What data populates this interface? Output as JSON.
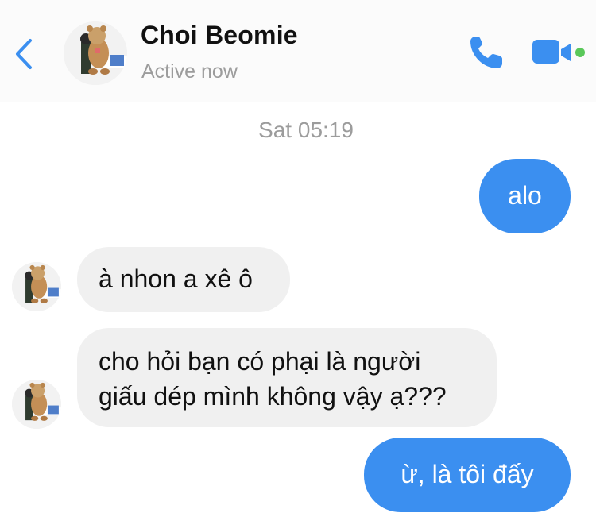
{
  "header": {
    "contact_name": "Choi Beomie",
    "status": "Active now",
    "icons": {
      "back": "chevron-left-icon",
      "call": "phone-icon",
      "video": "video-camera-icon"
    },
    "accent_color": "#3b8ff0",
    "online_color": "#5ac85a"
  },
  "conversation": {
    "timestamp": "Sat 05:19",
    "messages": [
      {
        "direction": "outgoing",
        "text": "alo"
      },
      {
        "direction": "incoming",
        "text": "à nhon a xê ô"
      },
      {
        "direction": "incoming",
        "lines": [
          "cho hỏi bạn có phại là người",
          "giấu dép mình không vậy ạ???"
        ]
      },
      {
        "direction": "outgoing",
        "text": "ừ, là tôi đấy"
      }
    ]
  }
}
